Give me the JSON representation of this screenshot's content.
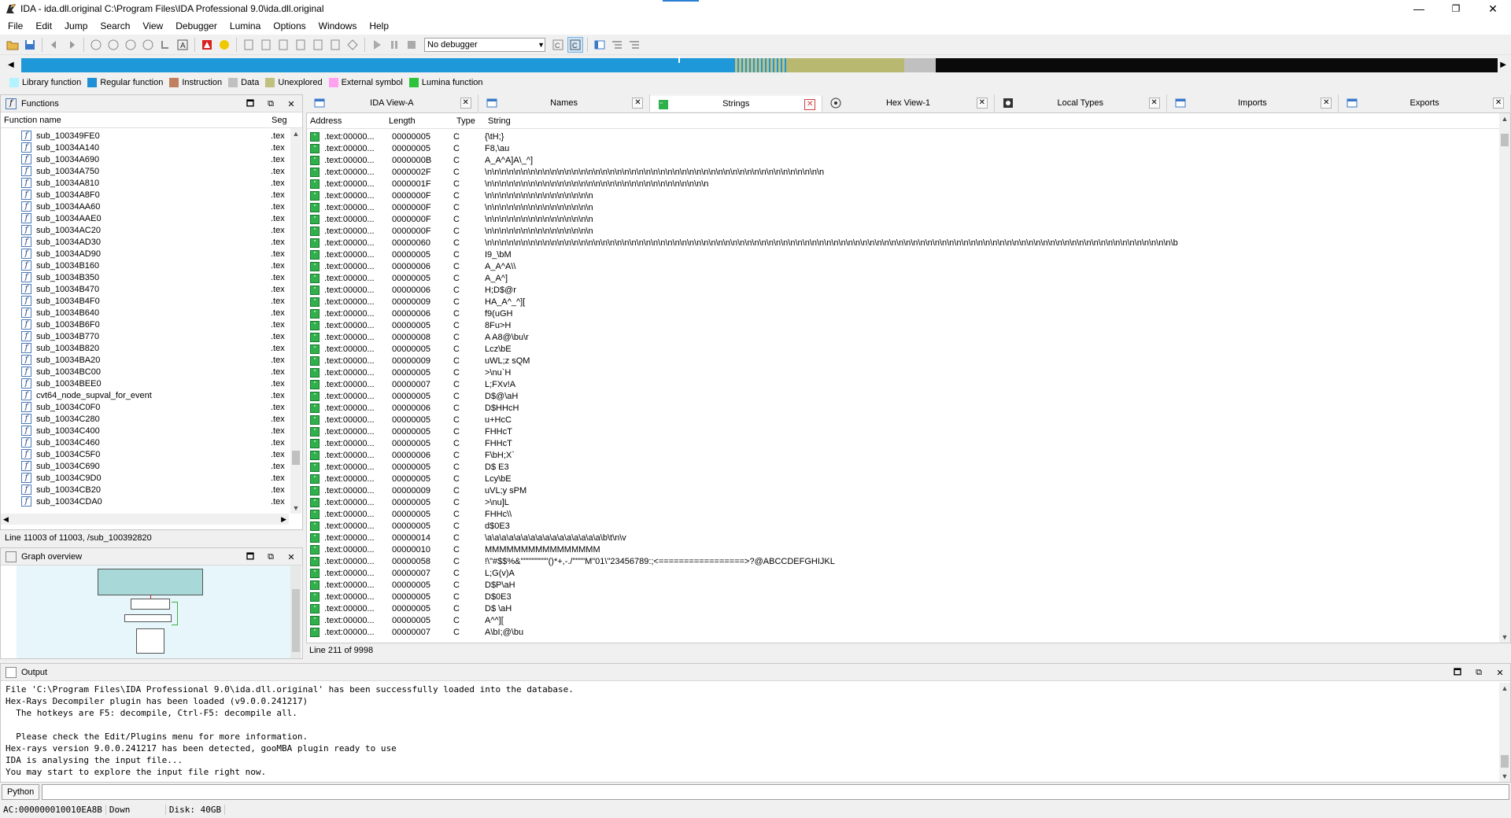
{
  "window": {
    "title": "IDA - ida.dll.original C:\\Program Files\\IDA Professional 9.0\\ida.dll.original",
    "minimize": "—",
    "maximize": "❐",
    "close": "✕"
  },
  "menu": [
    "File",
    "Edit",
    "Jump",
    "Search",
    "View",
    "Debugger",
    "Lumina",
    "Options",
    "Windows",
    "Help"
  ],
  "toolbar": {
    "debugger_select": "No debugger"
  },
  "legend": [
    {
      "label": "Library function",
      "color": "#b3f2ff"
    },
    {
      "label": "Regular function",
      "color": "#1e90d6"
    },
    {
      "label": "Instruction",
      "color": "#c08060"
    },
    {
      "label": "Data",
      "color": "#c0c0c0"
    },
    {
      "label": "Unexplored",
      "color": "#c0c080"
    },
    {
      "label": "External symbol",
      "color": "#ffa0f0"
    },
    {
      "label": "Lumina function",
      "color": "#2bc43a"
    }
  ],
  "functions": {
    "title": "Functions",
    "col_name": "Function name",
    "col_seg": "Seg",
    "rows": [
      {
        "name": "sub_100349FE0",
        "seg": ".tex"
      },
      {
        "name": "sub_10034A140",
        "seg": ".tex"
      },
      {
        "name": "sub_10034A690",
        "seg": ".tex"
      },
      {
        "name": "sub_10034A750",
        "seg": ".tex"
      },
      {
        "name": "sub_10034A810",
        "seg": ".tex"
      },
      {
        "name": "sub_10034A8F0",
        "seg": ".tex"
      },
      {
        "name": "sub_10034AA60",
        "seg": ".tex"
      },
      {
        "name": "sub_10034AAE0",
        "seg": ".tex"
      },
      {
        "name": "sub_10034AC20",
        "seg": ".tex"
      },
      {
        "name": "sub_10034AD30",
        "seg": ".tex"
      },
      {
        "name": "sub_10034AD90",
        "seg": ".tex"
      },
      {
        "name": "sub_10034B160",
        "seg": ".tex"
      },
      {
        "name": "sub_10034B350",
        "seg": ".tex"
      },
      {
        "name": "sub_10034B470",
        "seg": ".tex"
      },
      {
        "name": "sub_10034B4F0",
        "seg": ".tex"
      },
      {
        "name": "sub_10034B640",
        "seg": ".tex"
      },
      {
        "name": "sub_10034B6F0",
        "seg": ".tex"
      },
      {
        "name": "sub_10034B770",
        "seg": ".tex"
      },
      {
        "name": "sub_10034B820",
        "seg": ".tex"
      },
      {
        "name": "sub_10034BA20",
        "seg": ".tex"
      },
      {
        "name": "sub_10034BC00",
        "seg": ".tex"
      },
      {
        "name": "sub_10034BEE0",
        "seg": ".tex"
      },
      {
        "name": "cvt64_node_supval_for_event",
        "seg": ".tex"
      },
      {
        "name": "sub_10034C0F0",
        "seg": ".tex"
      },
      {
        "name": "sub_10034C280",
        "seg": ".tex"
      },
      {
        "name": "sub_10034C400",
        "seg": ".tex"
      },
      {
        "name": "sub_10034C460",
        "seg": ".tex"
      },
      {
        "name": "sub_10034C5F0",
        "seg": ".tex"
      },
      {
        "name": "sub_10034C690",
        "seg": ".tex"
      },
      {
        "name": "sub_10034C9D0",
        "seg": ".tex"
      },
      {
        "name": "sub_10034CB20",
        "seg": ".tex"
      },
      {
        "name": "sub_10034CDA0",
        "seg": ".tex"
      }
    ],
    "status": "Line 11003 of 11003, /sub_100392820"
  },
  "graph": {
    "title": "Graph overview"
  },
  "tabs": [
    {
      "label": "IDA View-A",
      "active": false
    },
    {
      "label": "Names",
      "active": false
    },
    {
      "label": "Strings",
      "active": true
    },
    {
      "label": "Hex View-1",
      "active": false
    },
    {
      "label": "Local Types",
      "active": false
    },
    {
      "label": "Imports",
      "active": false
    },
    {
      "label": "Exports",
      "active": false
    }
  ],
  "strings": {
    "col_address": "Address",
    "col_length": "Length",
    "col_type": "Type",
    "col_string": "String",
    "rows": [
      {
        "a": ".text:00000...",
        "l": "00000005",
        "t": "C",
        "s": "{\\tH;}"
      },
      {
        "a": ".text:00000...",
        "l": "00000005",
        "t": "C",
        "s": "F8,\\au"
      },
      {
        "a": ".text:00000...",
        "l": "0000000B",
        "t": "C",
        "s": "A_A^A]A\\_^]"
      },
      {
        "a": ".text:00000...",
        "l": "0000002F",
        "t": "C",
        "s": "\\n\\n\\n\\n\\n\\n\\n\\n\\n\\n\\n\\n\\n\\n\\n\\n\\n\\n\\n\\n\\n\\n\\n\\n\\n\\n\\n\\n\\n\\n\\n\\n\\n\\n\\n\\n\\n\\n\\n\\n\\n\\n\\n\\n\\n\\n\\n"
      },
      {
        "a": ".text:00000...",
        "l": "0000001F",
        "t": "C",
        "s": "\\n\\n\\n\\n\\n\\n\\n\\n\\n\\n\\n\\n\\n\\n\\n\\n\\n\\n\\n\\n\\n\\n\\n\\n\\n\\n\\n\\n\\n\\n\\n"
      },
      {
        "a": ".text:00000...",
        "l": "0000000F",
        "t": "C",
        "s": "\\n\\n\\n\\n\\n\\n\\n\\n\\n\\n\\n\\n\\n\\n\\n"
      },
      {
        "a": ".text:00000...",
        "l": "0000000F",
        "t": "C",
        "s": "\\n\\n\\n\\n\\n\\n\\n\\n\\n\\n\\n\\n\\n\\n\\n"
      },
      {
        "a": ".text:00000...",
        "l": "0000000F",
        "t": "C",
        "s": "\\n\\n\\n\\n\\n\\n\\n\\n\\n\\n\\n\\n\\n\\n\\n"
      },
      {
        "a": ".text:00000...",
        "l": "0000000F",
        "t": "C",
        "s": "\\n\\n\\n\\n\\n\\n\\n\\n\\n\\n\\n\\n\\n\\n\\n"
      },
      {
        "a": ".text:00000...",
        "l": "00000060",
        "t": "C",
        "s": "\\n\\n\\n\\n\\n\\n\\n\\n\\n\\n\\n\\n\\n\\n\\n\\n\\n\\n\\n\\n\\n\\n\\n\\n\\n\\n\\n\\n\\n\\n\\n\\n\\n\\n\\n\\n\\n\\n\\n\\n\\n\\n\\n\\n\\n\\n\\n\\n\\n\\n\\n\\n\\n\\n\\n\\n\\n\\n\\n\\n\\n\\n\\n\\n\\n\\n\\n\\n\\n\\n\\n\\n\\n\\n\\n\\n\\n\\n\\n\\n\\n\\n\\n\\n\\n\\n\\n\\n\\n\\n\\n\\n\\n\\n\\n\\b"
      },
      {
        "a": ".text:00000...",
        "l": "00000005",
        "t": "C",
        "s": "I9_\\bM"
      },
      {
        "a": ".text:00000...",
        "l": "00000006",
        "t": "C",
        "s": "A_A^A\\\\"
      },
      {
        "a": ".text:00000...",
        "l": "00000005",
        "t": "C",
        "s": " A_A^]"
      },
      {
        "a": ".text:00000...",
        "l": "00000006",
        "t": "C",
        "s": "H;D$@r"
      },
      {
        "a": ".text:00000...",
        "l": "00000009",
        "t": "C",
        "s": "HA_A^_^]["
      },
      {
        "a": ".text:00000...",
        "l": "00000006",
        "t": "C",
        "s": "f9(uGH"
      },
      {
        "a": ".text:00000...",
        "l": "00000005",
        "t": "C",
        "s": "8Fu>H"
      },
      {
        "a": ".text:00000...",
        "l": "00000008",
        "t": "C",
        "s": "A A8@\\bu\\r"
      },
      {
        "a": ".text:00000...",
        "l": "00000005",
        "t": "C",
        "s": "Lcz\\bE"
      },
      {
        "a": ".text:00000...",
        "l": "00000009",
        "t": "C",
        "s": "uWL;z sQM"
      },
      {
        "a": ".text:00000...",
        "l": "00000005",
        "t": "C",
        "s": ">\\nu`H"
      },
      {
        "a": ".text:00000...",
        "l": "00000007",
        "t": "C",
        "s": "L;FXv!A"
      },
      {
        "a": ".text:00000...",
        "l": "00000005",
        "t": "C",
        "s": "D$@\\aH"
      },
      {
        "a": ".text:00000...",
        "l": "00000006",
        "t": "C",
        "s": "D$HHcH"
      },
      {
        "a": ".text:00000...",
        "l": "00000005",
        "t": "C",
        "s": "u+HcC"
      },
      {
        "a": ".text:00000...",
        "l": "00000005",
        "t": "C",
        "s": "FHHcT"
      },
      {
        "a": ".text:00000...",
        "l": "00000005",
        "t": "C",
        "s": "FHHcT"
      },
      {
        "a": ".text:00000...",
        "l": "00000006",
        "t": "C",
        "s": "F\\bH;X`"
      },
      {
        "a": ".text:00000...",
        "l": "00000005",
        "t": "C",
        "s": "D$ E3"
      },
      {
        "a": ".text:00000...",
        "l": "00000005",
        "t": "C",
        "s": "Lcy\\bE"
      },
      {
        "a": ".text:00000...",
        "l": "00000009",
        "t": "C",
        "s": "uVL;y sPM"
      },
      {
        "a": ".text:00000...",
        "l": "00000005",
        "t": "C",
        "s": ">\\nu]L"
      },
      {
        "a": ".text:00000...",
        "l": "00000005",
        "t": "C",
        "s": "FHHc\\\\"
      },
      {
        "a": ".text:00000...",
        "l": "00000005",
        "t": "C",
        "s": "d$0E3"
      },
      {
        "a": ".text:00000...",
        "l": "00000014",
        "t": "C",
        "s": "\\a\\a\\a\\a\\a\\a\\a\\a\\a\\a\\a\\a\\a\\a\\a\\a\\b\\t\\n\\v"
      },
      {
        "a": ".text:00000...",
        "l": "00000010",
        "t": "C",
        "s": "MMMMMMMMMMMMMMMM"
      },
      {
        "a": ".text:00000...",
        "l": "00000058",
        "t": "C",
        "s": " !\\\"#$$%&\"\"\"\"\"\"\"\"\"()*+,-./\"\"\"\"M\"01\\\"23456789:;<=================>?@ABCCDEFGHIJKL"
      },
      {
        "a": ".text:00000...",
        "l": "00000007",
        "t": "C",
        "s": "L;G(v)A"
      },
      {
        "a": ".text:00000...",
        "l": "00000005",
        "t": "C",
        "s": "D$P\\aH"
      },
      {
        "a": ".text:00000...",
        "l": "00000005",
        "t": "C",
        "s": "D$0E3"
      },
      {
        "a": ".text:00000...",
        "l": "00000005",
        "t": "C",
        "s": "D$ \\aH"
      },
      {
        "a": ".text:00000...",
        "l": "00000005",
        "t": "C",
        "s": "A^^]["
      },
      {
        "a": ".text:00000...",
        "l": "00000007",
        "t": "C",
        "s": "A\\bI;@\\bu"
      }
    ],
    "status": "Line 211 of 9998"
  },
  "output": {
    "title": "Output",
    "lines": [
      "File 'C:\\Program Files\\IDA Professional 9.0\\ida.dll.original' has been successfully loaded into the database.",
      "Hex-Rays Decompiler plugin has been loaded (v9.0.0.241217)",
      "  The hotkeys are F5: decompile, Ctrl-F5: decompile all.",
      "",
      "  Please check the Edit/Plugins menu for more information.",
      "Hex-rays version 9.0.0.241217 has been detected, gooMBA plugin ready to use",
      "IDA is analysing the input file...",
      "You may start to explore the input file right now."
    ]
  },
  "python": {
    "label": "Python"
  },
  "status": {
    "address": "AC:000000010010EA8B",
    "direction": "Down",
    "disk": "Disk: 40GB"
  }
}
